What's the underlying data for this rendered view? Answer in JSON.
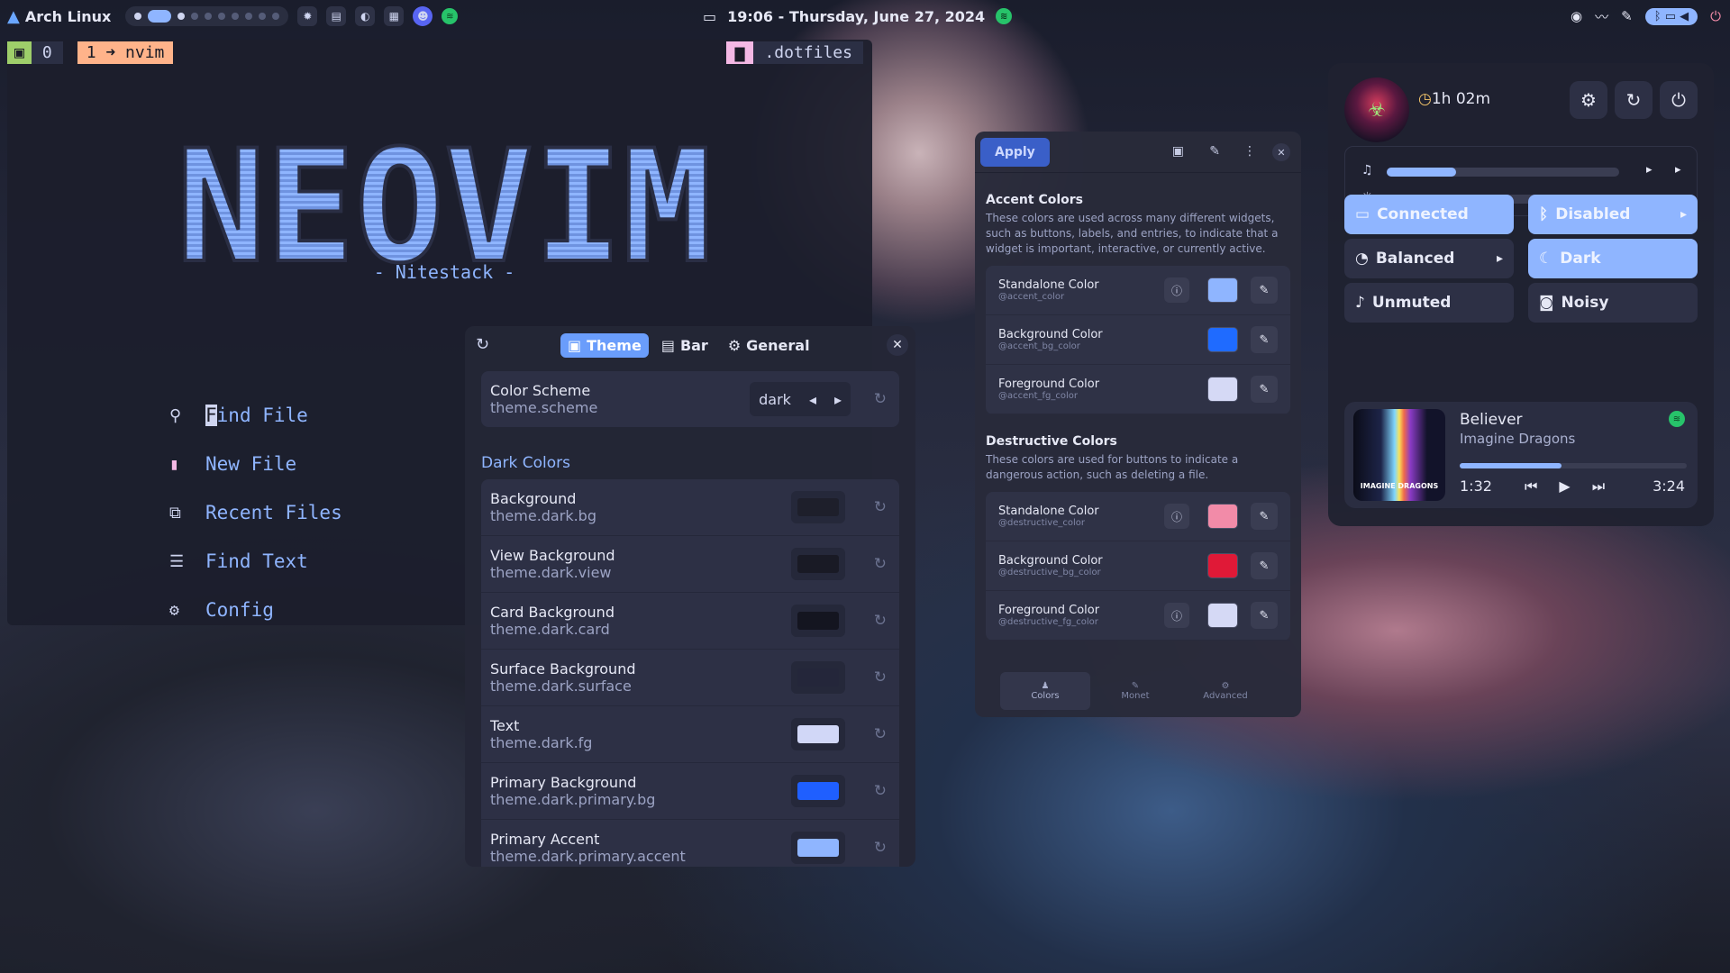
{
  "topbar": {
    "distro": "Arch Linux",
    "datetime": "19:06 - Thursday, June 27, 2024"
  },
  "nvim": {
    "mode_icon": "▣",
    "zero": "0",
    "tab": "1 ➜ nvim",
    "folder": ".dotfiles",
    "banner": "NEOVIM",
    "subtitle": "- Nitestack -",
    "menu": [
      {
        "icon": "search-icon",
        "rest": "ind File",
        "first": "F"
      },
      {
        "icon": "new-file-icon",
        "label": "New File"
      },
      {
        "icon": "recent-files-icon",
        "label": "Recent Files"
      },
      {
        "icon": "find-text-icon",
        "label": "Find Text"
      },
      {
        "icon": "gear-icon",
        "label": "Config"
      }
    ]
  },
  "theme_panel": {
    "tabs": [
      "Theme",
      "Bar",
      "General"
    ],
    "scheme": {
      "label": "Color Scheme",
      "key": "theme.scheme",
      "value": "dark"
    },
    "section": "Dark Colors",
    "rows": [
      {
        "label": "Background",
        "key": "theme.dark.bg",
        "color": "#1e1f2b"
      },
      {
        "label": "View Background",
        "key": "theme.dark.view",
        "color": "#191a25"
      },
      {
        "label": "Card Background",
        "key": "theme.dark.card",
        "color": "#141520"
      },
      {
        "label": "Surface Background",
        "key": "theme.dark.surface",
        "color": "#24263a"
      },
      {
        "label": "Text",
        "key": "theme.dark.fg",
        "color": "#d1d7f7"
      },
      {
        "label": "Primary Background",
        "key": "theme.dark.primary.bg",
        "color": "#1f5fff"
      },
      {
        "label": "Primary Accent",
        "key": "theme.dark.primary.accent",
        "color": "#8fb5ff"
      }
    ]
  },
  "adw_panel": {
    "apply": "Apply",
    "accent_title": "Accent Colors",
    "accent_desc": "These colors are used across many different widgets, such as buttons, labels, and entries, to indicate that a widget is important, interactive, or currently active.",
    "accent_rows": [
      {
        "label": "Standalone Color",
        "key": "@accent_color",
        "color": "#8fb5ff",
        "info": true
      },
      {
        "label": "Background Color",
        "key": "@accent_bg_color",
        "color": "#1f6bff",
        "info": false
      },
      {
        "label": "Foreground Color",
        "key": "@accent_fg_color",
        "color": "#d5d9f5",
        "info": false
      }
    ],
    "destructive_title": "Destructive Colors",
    "destructive_desc": "These colors are used for buttons to indicate a dangerous action, such as deleting a file.",
    "destructive_rows": [
      {
        "label": "Standalone Color",
        "key": "@destructive_color",
        "color": "#f28ba8",
        "info": true
      },
      {
        "label": "Background Color",
        "key": "@destructive_bg_color",
        "color": "#e01937",
        "info": false
      },
      {
        "label": "Foreground Color",
        "key": "@destructive_fg_color",
        "color": "#d5d9f5",
        "info": true
      }
    ],
    "footer": [
      "Colors",
      "Monet",
      "Advanced"
    ]
  },
  "quick_settings": {
    "uptime": "1h 02m",
    "volume_level": 0.3,
    "brightness_level": 0.21,
    "tiles": [
      {
        "label": "Connected",
        "on": true,
        "icon": "ethernet-icon",
        "chevron": false
      },
      {
        "label": "Disabled",
        "on": true,
        "icon": "bluetooth-icon",
        "chevron": true
      },
      {
        "label": "Balanced",
        "on": false,
        "icon": "power-profile-icon",
        "chevron": true
      },
      {
        "label": "Dark",
        "on": true,
        "icon": "moon-icon",
        "chevron": false
      },
      {
        "label": "Unmuted",
        "on": false,
        "icon": "microphone-icon",
        "chevron": false
      },
      {
        "label": "Noisy",
        "on": false,
        "icon": "notifications-icon",
        "chevron": false
      }
    ],
    "media": {
      "title": "Believer",
      "artist": "Imagine Dragons",
      "elapsed": "1:32",
      "duration": "3:24",
      "progress": 0.45,
      "cover_text": "IMAGINE DRAGONS"
    }
  }
}
